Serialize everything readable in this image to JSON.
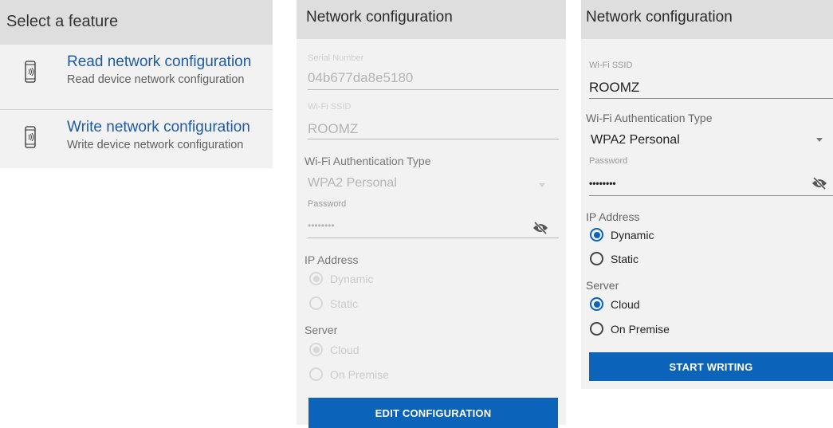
{
  "feature_screen": {
    "title": "Select a feature",
    "features": [
      {
        "title": "Read network configuration",
        "subtitle": "Read device network configuration",
        "icon": "nfc-phone-icon"
      },
      {
        "title": "Write network configuration",
        "subtitle": "Write device network configuration",
        "icon": "nfc-phone-icon"
      }
    ]
  },
  "read_screen": {
    "title": "Network configuration",
    "serial_label": "Serial Number",
    "serial_value": "04b677da8e5180",
    "ssid_label": "Wi-Fi SSID",
    "ssid_value": "ROOMZ",
    "auth_label": "Wi-Fi Authentication Type",
    "auth_value": "WPA2 Personal",
    "password_label": "Password",
    "password_value": "••••••••",
    "ip_label": "IP Address",
    "ip_options": [
      "Dynamic",
      "Static"
    ],
    "ip_selected": "Dynamic",
    "server_label": "Server",
    "server_options": [
      "Cloud",
      "On Premise"
    ],
    "server_selected": "Cloud",
    "button_label": "EDIT CONFIGURATION"
  },
  "write_screen": {
    "title": "Network configuration",
    "ssid_label": "Wi-Fi SSID",
    "ssid_value": "ROOMZ",
    "auth_label": "Wi-Fi Authentication Type",
    "auth_value": "WPA2 Personal",
    "password_label": "Password",
    "password_value": "••••••••",
    "ip_label": "IP Address",
    "ip_options": [
      "Dynamic",
      "Static"
    ],
    "ip_selected": "Dynamic",
    "server_label": "Server",
    "server_options": [
      "Cloud",
      "On Premise"
    ],
    "server_selected": "Cloud",
    "button_label": "START WRITING"
  },
  "colors": {
    "accent": "#0b63ba",
    "header_bg": "#dedede",
    "panel_bg": "#f2f2f2",
    "link_blue": "#1e5aa8"
  }
}
